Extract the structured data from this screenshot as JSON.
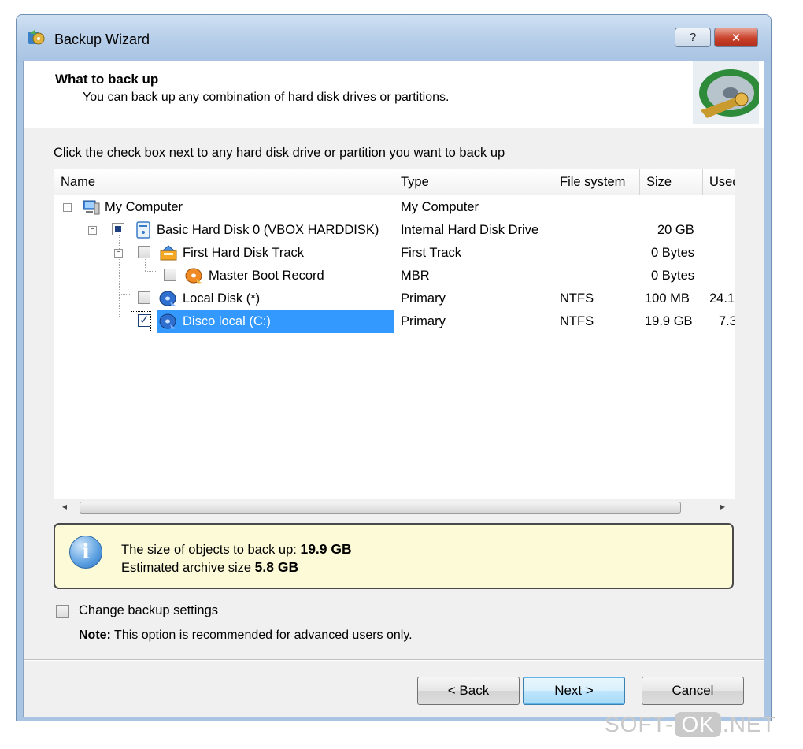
{
  "window": {
    "title": "Backup Wizard",
    "help_label": "?",
    "close_label": "✕"
  },
  "header": {
    "title": "What to back up",
    "subtitle": "You can back up any combination of hard disk drives or partitions."
  },
  "instruction": "Click the check box next to any hard disk drive or partition you want to back up",
  "columns": [
    "Name",
    "Type",
    "File system",
    "Size",
    "Used"
  ],
  "rows": [
    {
      "name": "My Computer",
      "type": "My Computer",
      "fs": "",
      "size": "",
      "used": ""
    },
    {
      "name": "Basic Hard Disk 0 (VBOX HARDDISK)",
      "type": "Internal Hard Disk Drive",
      "fs": "",
      "size": "20 GB",
      "used": ""
    },
    {
      "name": "First Hard Disk Track",
      "type": "First Track",
      "fs": "",
      "size": "0 Bytes",
      "used": ""
    },
    {
      "name": "Master Boot Record",
      "type": "MBR",
      "fs": "",
      "size": "0 Bytes",
      "used": ""
    },
    {
      "name": "Local Disk (*)",
      "type": "Primary",
      "fs": "NTFS",
      "size": "100 MB",
      "used": "24.1"
    },
    {
      "name": "Disco local (C:)",
      "type": "Primary",
      "fs": "NTFS",
      "size": "19.9 GB",
      "used": "7.3"
    }
  ],
  "info": {
    "size_label": "The size of objects to back up:",
    "size_value": "19.9 GB",
    "archive_label": "Estimated archive size",
    "archive_value": "5.8 GB"
  },
  "settings": {
    "checkbox_label": "Change backup settings",
    "note_label": "Note:",
    "note_text": "This option is recommended for advanced users only."
  },
  "buttons": {
    "back": "< Back",
    "next": "Next >",
    "cancel": "Cancel"
  },
  "watermark": {
    "left": "SOFT-",
    "mid": "OK",
    "right": ".NET"
  },
  "colors": {
    "selection": "#3399ff",
    "info_bg": "#fdfbd7",
    "title_bar": "#b5cde8"
  }
}
